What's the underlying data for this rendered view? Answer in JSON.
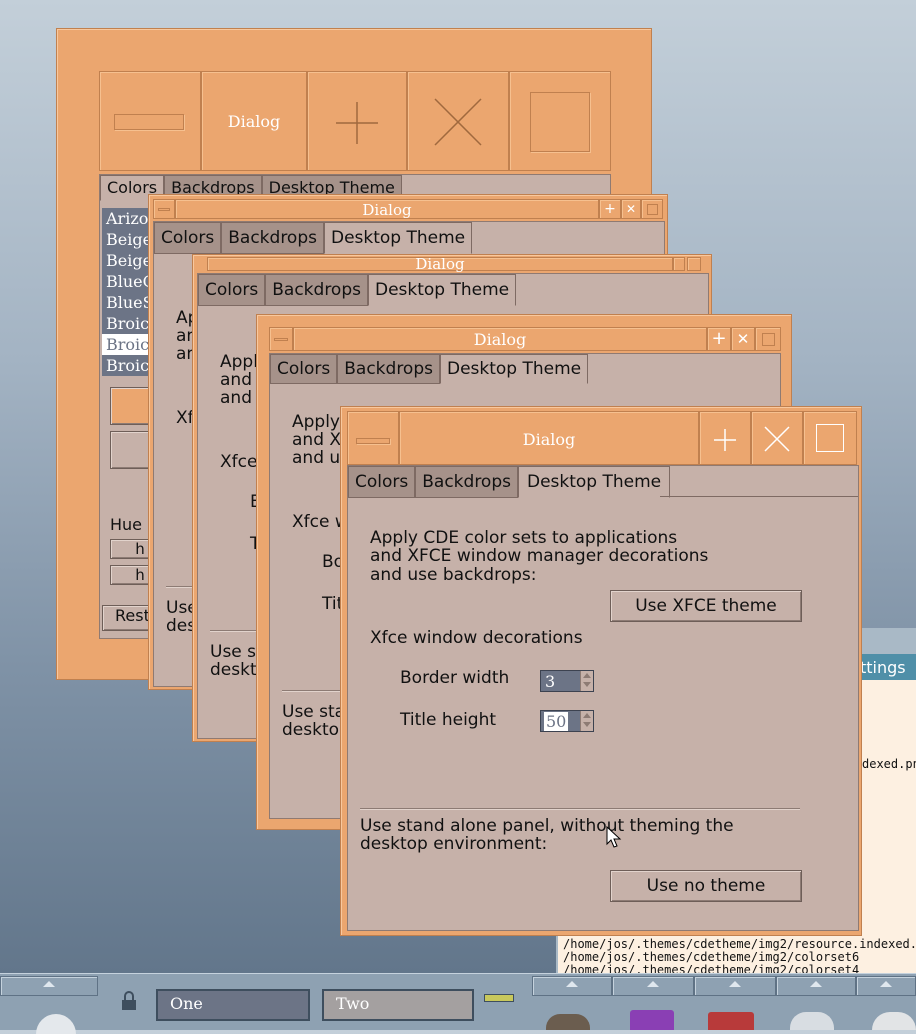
{
  "win_title": "Dialog",
  "tabs": [
    "Colors",
    "Backdrops",
    "Desktop Theme"
  ],
  "colorsets": [
    "Arizo",
    "Beige",
    "Beige",
    "BlueG",
    "BlueS",
    "Broic",
    "Broic",
    "Broic"
  ],
  "back_window": {
    "hue": "Hue",
    "h1": "h",
    "h2": "h",
    "rest": "Rest",
    "use": "Use",
    "desk": "desk"
  },
  "frag_a": {
    "ap": "Ap",
    "an": "an",
    "an2": "an",
    "xf": "Xf",
    "use": "Use",
    "desk": "des"
  },
  "frag_b": {
    "appl": "Appl",
    "and1": "and",
    "and2": "and",
    "xfce": "Xfce",
    "b": "B",
    "t": "T",
    "use": "Use st",
    "desk": "deskto"
  },
  "frag_c": {
    "apply": "Apply",
    "and1": "and XI",
    "and2": "and us",
    "xfce": "Xfce w",
    "bor": "Bor",
    "tit": "Tit",
    "use": "Use sta",
    "desk": "desktor"
  },
  "front": {
    "desc1": "Apply CDE color sets to applications",
    "desc2": "and XFCE window manager decorations",
    "desc3": "and use backdrops:",
    "use_xfce_btn": "Use XFCE theme",
    "xfce_decorations": "Xfce window decorations",
    "border_width_label": "Border width",
    "border_width_value": "3",
    "title_height_label": "Title height",
    "title_height_value": "50",
    "standalone1": "Use stand alone panel, without theming the",
    "standalone2": "desktop environment:",
    "no_theme_btn": "Use no theme"
  },
  "settings_window": {
    "title": "ttings",
    "line0": "dexed.pn",
    "line1": "/home/jos/.themes/cdetheme/img2/resource.indexed.pn",
    "line2": "/home/jos/.themes/cdetheme/img2/colorset6",
    "line3": "/home/jos/.themes/cdetheme/img2/colorset4"
  },
  "panel": {
    "workspace1": "One",
    "workspace2": "Two"
  },
  "colors": {
    "frame": "#eba66f",
    "client": "#c6b1a9",
    "selection": "#6c7486",
    "panel": "#8ea1b2"
  }
}
